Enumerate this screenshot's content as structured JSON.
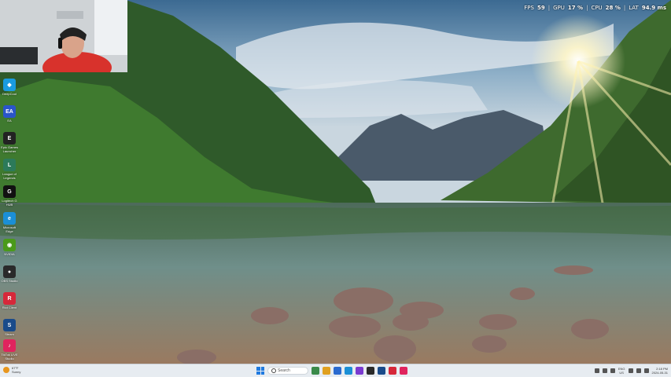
{
  "perf_overlay": {
    "fps_label": "FPS",
    "fps_value": "59",
    "gpu_label": "GPU",
    "gpu_value": "17 %",
    "cpu_label": "CPU",
    "cpu_value": "28 %",
    "lat_label": "LAT",
    "lat_value": "94.9 ms"
  },
  "desktop_icons": [
    {
      "label": "DeepCool",
      "icon": "deepcool-icon",
      "color": "#1a9be0"
    },
    {
      "label": "EA",
      "icon": "ea-icon",
      "color": "#2a55c9"
    },
    {
      "label": "Epic Games Launcher",
      "icon": "epic-games-icon",
      "color": "#222222"
    },
    {
      "label": "League of Legends",
      "icon": "league-icon",
      "color": "#2c7a5a"
    },
    {
      "label": "Logitech G HUB",
      "icon": "logitech-icon",
      "color": "#111111"
    },
    {
      "label": "Microsoft Edge",
      "icon": "edge-icon",
      "color": "#1b8fd6"
    },
    {
      "label": "NVIDIA",
      "icon": "nvidia-icon",
      "color": "#4a9a1a"
    },
    {
      "label": "OBS Studio",
      "icon": "obs-icon",
      "color": "#2a2a2a"
    },
    {
      "label": "Riot Client",
      "icon": "riot-icon",
      "color": "#d6283a"
    },
    {
      "label": "Steam",
      "icon": "steam-icon",
      "color": "#1a4b8a"
    },
    {
      "label": "TikTok LIVE Studio",
      "icon": "tiktok-icon",
      "color": "#e0245e"
    }
  ],
  "taskbar": {
    "weather_temp": "67°F",
    "weather_desc": "Sunny",
    "search_placeholder": "Search",
    "apps": [
      {
        "icon": "app-icon-1",
        "color": "#3a8a4a"
      },
      {
        "icon": "app-icon-2",
        "color": "#e0a020"
      },
      {
        "icon": "app-icon-3",
        "color": "#2a6ad0"
      },
      {
        "icon": "app-icon-4",
        "color": "#1b8fd6"
      },
      {
        "icon": "app-icon-5",
        "color": "#7a3ad0"
      },
      {
        "icon": "app-icon-6",
        "color": "#2a2a2a"
      },
      {
        "icon": "app-icon-7",
        "color": "#1a4b8a"
      },
      {
        "icon": "app-icon-8",
        "color": "#d6283a"
      },
      {
        "icon": "app-icon-9",
        "color": "#e0245e"
      }
    ],
    "lang_top": "ENG",
    "lang_bottom": "US",
    "time": "2:18 PM",
    "date": "2024-05-31"
  }
}
